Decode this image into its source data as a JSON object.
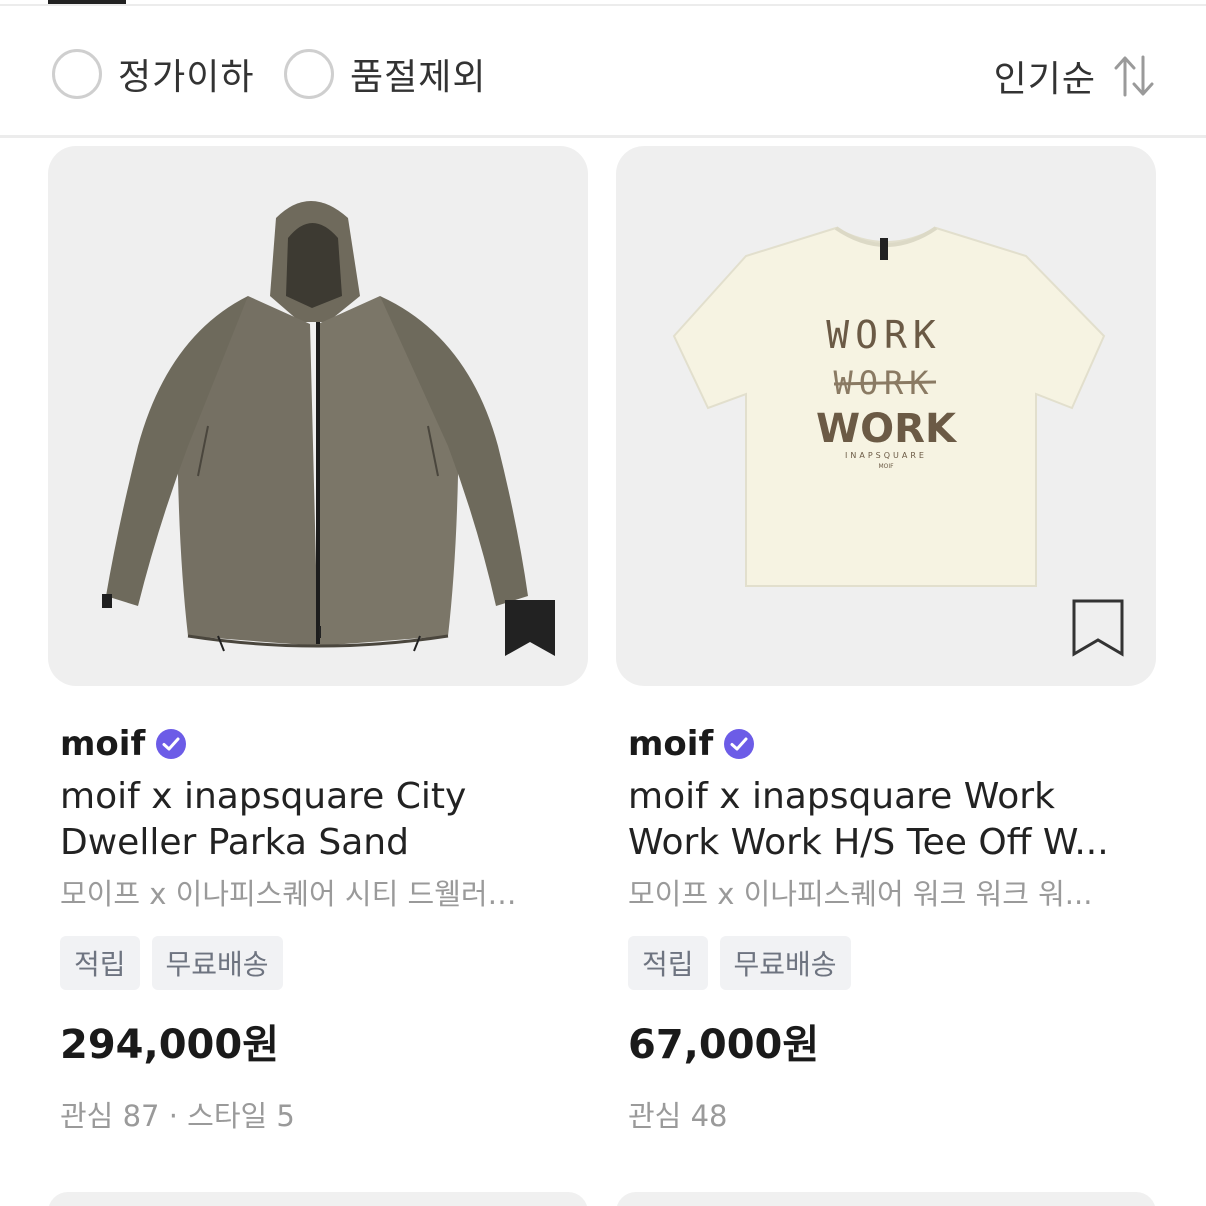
{
  "filters": [
    {
      "label": "정가이하",
      "checked": false
    },
    {
      "label": "품절제외",
      "checked": false
    }
  ],
  "sort": {
    "label": "인기순",
    "icon": "sort-arrows-icon"
  },
  "products": [
    {
      "brand": "moif",
      "verified_icon": "verified-badge-icon",
      "title": "moif x inapsquare City Dweller Parka Sand",
      "subtitle": "모이프 x 이나피스퀘어 시티 드웰러…",
      "badges": [
        "적립",
        "무료배송"
      ],
      "price": "294,000원",
      "meta": "관심 87 · 스타일 5",
      "bookmarked": true,
      "image": "hooded-parka-jacket"
    },
    {
      "brand": "moif",
      "verified_icon": "verified-badge-icon",
      "title": "moif x inapsquare Work Work Work H/S Tee Off W...",
      "subtitle": "모이프 x 이나피스퀘어 워크 워크 워...",
      "badges": [
        "적립",
        "무료배송"
      ],
      "price": "67,000원",
      "meta": "관심 48",
      "bookmarked": false,
      "image": "work-tee-shirt",
      "print_text": [
        "WORK",
        "WORK",
        "WORK",
        "INAPSQUARE",
        "MOIF"
      ]
    }
  ],
  "colors": {
    "verified": "#6c5ce7",
    "badge_bg": "#f1f2f4",
    "bookmark_fill": "#222222"
  }
}
